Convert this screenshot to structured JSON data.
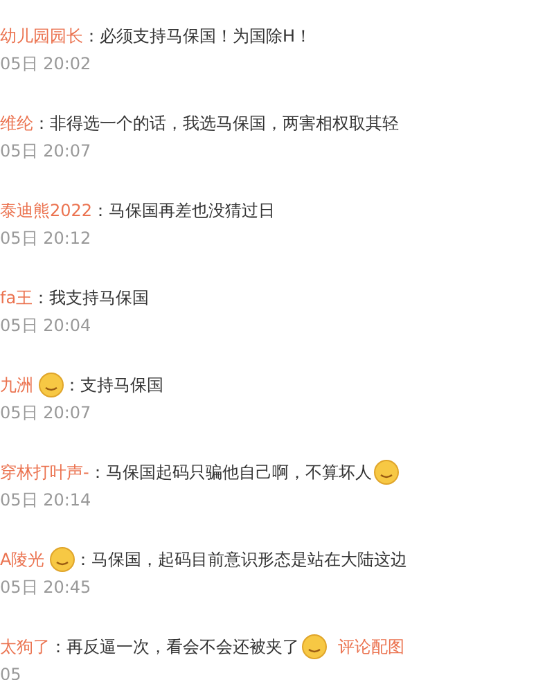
{
  "comments": [
    {
      "user": "幼儿园园长",
      "badge": false,
      "text": "：必须支持马保国！为国除H！",
      "end_emoji": false,
      "time": "05日 20:02"
    },
    {
      "user": "维纶",
      "badge": false,
      "text": "：非得选一个的话，我选马保国，两害相权取其轻",
      "end_emoji": false,
      "time": "05日 20:07"
    },
    {
      "user": "泰迪熊2022",
      "badge": false,
      "text": "：马保国再差也没猜过日",
      "end_emoji": false,
      "time": "05日 20:12"
    },
    {
      "user": "fa王",
      "badge": false,
      "text": "：我支持马保国",
      "end_emoji": false,
      "time": "05日 20:04"
    },
    {
      "user": "九洲",
      "badge": true,
      "text": "：支持马保国",
      "end_emoji": false,
      "time": "05日 20:07"
    },
    {
      "user": "穿林打叶声-",
      "badge": false,
      "text": "：马保国起码只骗他自己啊，不算坏人",
      "end_emoji": true,
      "time": "05日 20:14"
    },
    {
      "user": "A陵光",
      "badge": true,
      "text": "：马保国，起码目前意识形态是站在大陆这边",
      "end_emoji": false,
      "time": "05日 20:45"
    },
    {
      "user": "太狗了",
      "badge": false,
      "text": "：再反逼一次，看会不会还被夹了",
      "end_emoji": true,
      "link": "评论配图",
      "time": "05"
    }
  ]
}
